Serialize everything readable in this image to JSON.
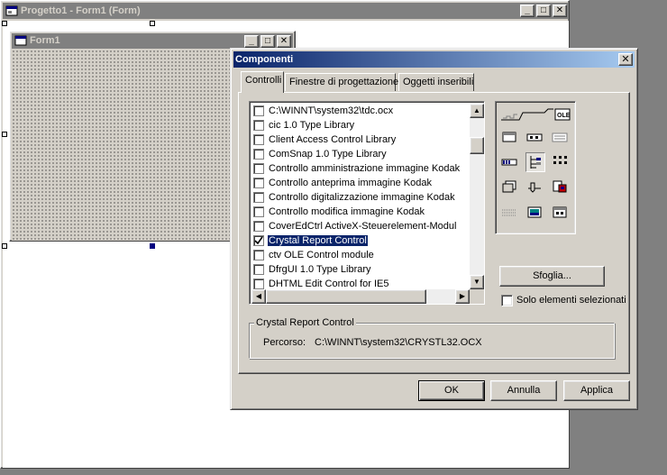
{
  "project_window": {
    "title": "Progetto1 - Form1 (Form)",
    "minimize": "_",
    "maximize": "□",
    "close": "✕"
  },
  "form1": {
    "title": "Form1",
    "minimize": "_",
    "maximize": "□",
    "close": "✕"
  },
  "dialog": {
    "title": "Componenti",
    "close": "✕",
    "tabs": [
      {
        "label": "Controlli"
      },
      {
        "label": "Finestre di progettazione"
      },
      {
        "label": "Oggetti inseribili"
      }
    ],
    "components": [
      {
        "label": "C:\\WINNT\\system32\\tdc.ocx",
        "checked": false,
        "selected": false
      },
      {
        "label": "cic 1.0 Type Library",
        "checked": false,
        "selected": false
      },
      {
        "label": "Client Access Control Library",
        "checked": false,
        "selected": false
      },
      {
        "label": "ComSnap 1.0 Type Library",
        "checked": false,
        "selected": false
      },
      {
        "label": "Controllo amministrazione immagine Kodak",
        "checked": false,
        "selected": false
      },
      {
        "label": "Controllo anteprima immagine Kodak",
        "checked": false,
        "selected": false
      },
      {
        "label": "Controllo digitalizzazione immagine Kodak",
        "checked": false,
        "selected": false
      },
      {
        "label": "Controllo modifica immagine Kodak",
        "checked": false,
        "selected": false
      },
      {
        "label": "CoverEdCtrl ActiveX-Steuerelement-Modul",
        "checked": false,
        "selected": false
      },
      {
        "label": "Crystal Report Control",
        "checked": true,
        "selected": true
      },
      {
        "label": "ctv OLE Control module",
        "checked": false,
        "selected": false
      },
      {
        "label": "DfrgUI 1.0 Type Library",
        "checked": false,
        "selected": false
      },
      {
        "label": "DHTML Edit Control for IE5",
        "checked": false,
        "selected": false
      }
    ],
    "scroll": {
      "up": "▲",
      "down": "▼",
      "left": "◀",
      "right": "▶"
    },
    "preview_ole_label": "OLE",
    "browse_button": "Sfoglia...",
    "selected_only_label": "Solo elementi selezionati",
    "selected_only_checked": false,
    "group": {
      "title": "Crystal Report Control",
      "path_label": "Percorso:",
      "path_value": "C:\\WINNT\\system32\\CRYSTL32.OCX"
    },
    "buttons": {
      "ok": "OK",
      "cancel": "Annulla",
      "apply": "Applica"
    }
  },
  "colors": {
    "active_title_start": "#0a246a",
    "active_title_end": "#a6caf0",
    "inactive_title": "#808080",
    "face": "#d4d0c8",
    "selection": "#0a246a"
  }
}
